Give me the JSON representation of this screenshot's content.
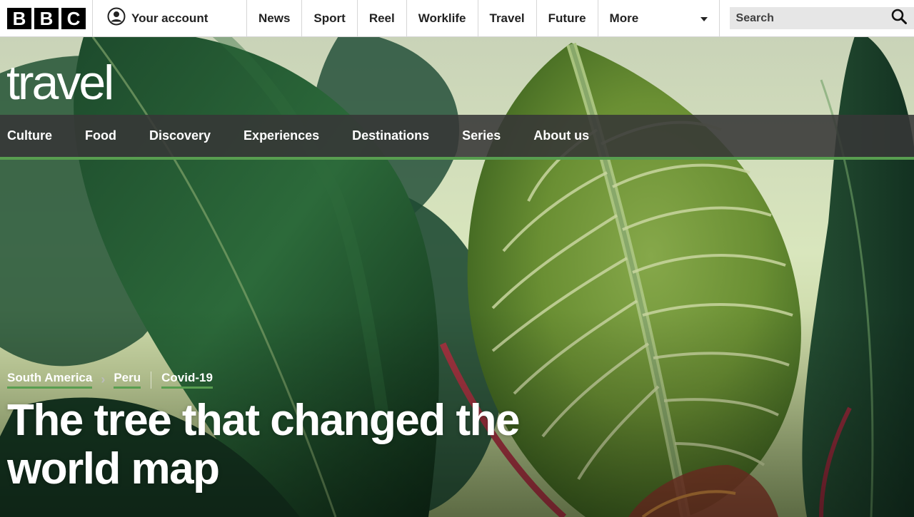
{
  "header": {
    "logo_letters": [
      "B",
      "B",
      "C"
    ],
    "account_label": "Your account",
    "nav": [
      "News",
      "Sport",
      "Reel",
      "Worklife",
      "Travel",
      "Future"
    ],
    "more_label": "More",
    "search_placeholder": "Search"
  },
  "section": {
    "brand": "travel",
    "nav": [
      "Culture",
      "Food",
      "Discovery",
      "Experiences",
      "Destinations",
      "Series",
      "About us"
    ]
  },
  "article": {
    "breadcrumbs": [
      "South America",
      "Peru"
    ],
    "tag": "Covid-19",
    "title": "The tree that changed the world map"
  },
  "colors": {
    "accent_green": "#589e50",
    "section_nav_bg": "#373737"
  },
  "icons": {
    "account": "user-circle-icon",
    "search": "magnifier-icon",
    "more": "caret-down-icon"
  }
}
